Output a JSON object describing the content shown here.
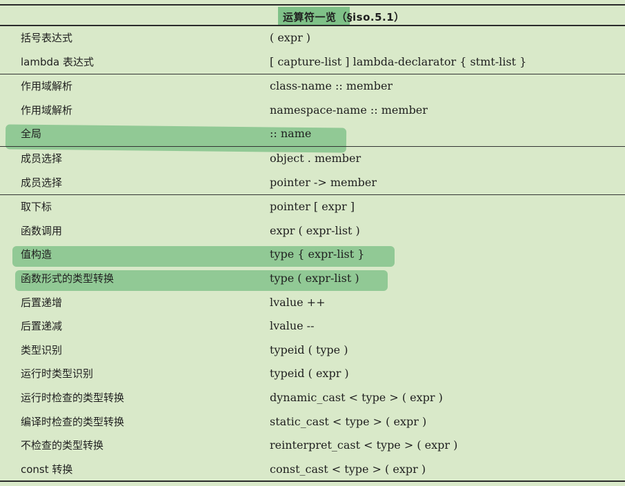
{
  "title": "运算符一览（§iso.5.1）",
  "rows": [
    {
      "name": "括号表达式",
      "syntax": "( expr )"
    },
    {
      "name": "lambda 表达式",
      "syntax": "[ capture-list ] lambda-declarator { stmt-list }"
    },
    {
      "name": "作用域解析",
      "syntax": "class-name :: member"
    },
    {
      "name": "作用域解析",
      "syntax": "namespace-name :: member"
    },
    {
      "name": "全局",
      "syntax": ":: name"
    },
    {
      "name": "成员选择",
      "syntax": "object . member"
    },
    {
      "name": "成员选择",
      "syntax": "pointer -> member"
    },
    {
      "name": "取下标",
      "syntax": "pointer [ expr ]"
    },
    {
      "name": "函数调用",
      "syntax": "expr ( expr-list )"
    },
    {
      "name": "值构造",
      "syntax": "type { expr-list }"
    },
    {
      "name": "函数形式的类型转换",
      "syntax": "type ( expr-list )"
    },
    {
      "name": "后置递增",
      "syntax": "lvalue ++"
    },
    {
      "name": "后置递减",
      "syntax": "lvalue --"
    },
    {
      "name": "类型识别",
      "syntax": "typeid ( type )"
    },
    {
      "name": "运行时类型识别",
      "syntax": "typeid ( expr )"
    },
    {
      "name": "运行时检查的类型转换",
      "syntax": "dynamic_cast < type > ( expr )"
    },
    {
      "name": "编译时检查的类型转换",
      "syntax": "static_cast < type > ( expr )"
    },
    {
      "name": "不检查的类型转换",
      "syntax": "reinterpret_cast < type > ( expr )"
    },
    {
      "name": "const 转换",
      "syntax": "const_cast < type > ( expr )"
    }
  ]
}
